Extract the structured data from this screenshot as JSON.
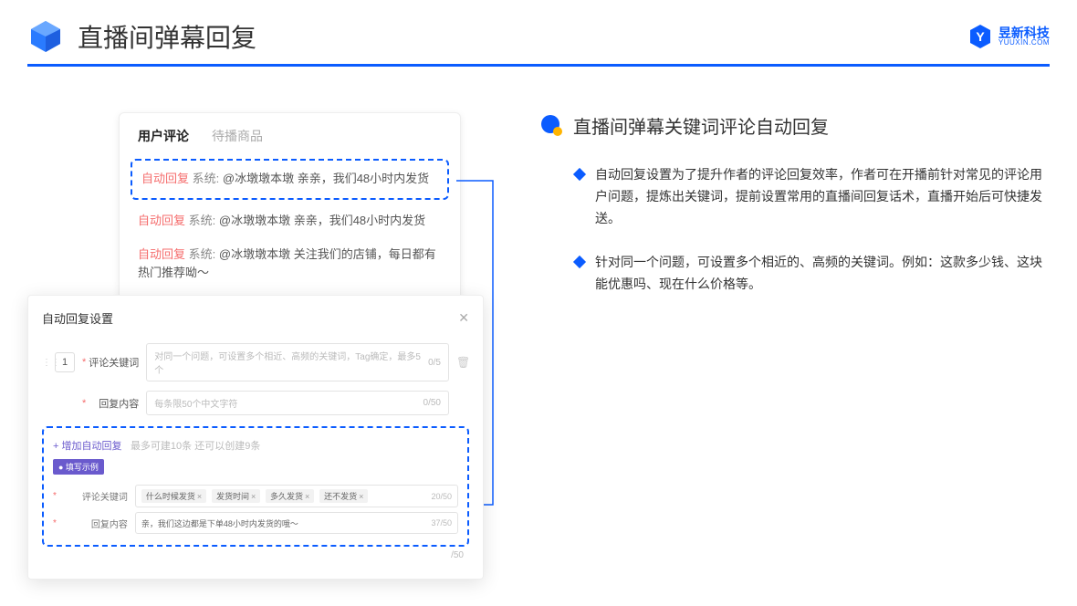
{
  "header": {
    "title": "直播间弹幕回复",
    "logo_main": "昱新科技",
    "logo_sub": "YUUXIN.COM"
  },
  "comments": {
    "tab_active": "用户评论",
    "tab_inactive": "待播商品",
    "rows": [
      {
        "tag": "自动回复",
        "sys": "系统:",
        "text": "@冰墩墩本墩 亲亲，我们48小时内发货"
      },
      {
        "tag": "自动回复",
        "sys": "系统:",
        "text": "@冰墩墩本墩 亲亲，我们48小时内发货"
      },
      {
        "tag": "自动回复",
        "sys": "系统:",
        "text": "@冰墩墩本墩 关注我们的店铺，每日都有热门推荐呦～"
      }
    ]
  },
  "settings": {
    "title": "自动回复设置",
    "close": "✕",
    "seq": "1",
    "label_keyword": "评论关键词",
    "placeholder_keyword": "对同一个问题，可设置多个相近、高频的关键词，Tag确定，最多5个",
    "counter_keyword": "0/5",
    "label_content": "回复内容",
    "placeholder_content": "每条限50个中文字符",
    "counter_content": "0/50",
    "add_link": "+ 增加自动回复",
    "add_hint": "最多可建10条 还可以创建9条",
    "example_badge": "● 填写示例",
    "ex_label_keyword": "评论关键词",
    "ex_chips": [
      "什么时候发货",
      "发货时间",
      "多久发货",
      "还不发货"
    ],
    "ex_counter_keyword": "20/50",
    "ex_label_content": "回复内容",
    "ex_content": "亲，我们这边都是下单48小时内发货的哦～",
    "ex_counter_content": "37/50",
    "bottom_counter": "/50"
  },
  "right": {
    "title": "直播间弹幕关键词评论自动回复",
    "bullets": [
      "自动回复设置为了提升作者的评论回复效率，作者可在开播前针对常见的评论用户问题，提炼出关键词，提前设置常用的直播间回复话术，直播开始后可快捷发送。",
      "针对同一个问题，可设置多个相近的、高频的关键词。例如：这款多少钱、这块能优惠吗、现在什么价格等。"
    ]
  }
}
